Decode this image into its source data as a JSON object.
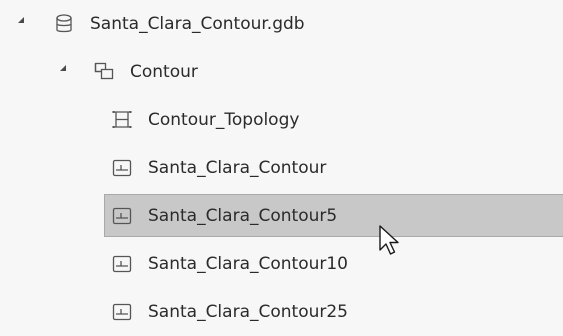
{
  "tree": {
    "database": {
      "label": "Santa_Clara_Contour.gdb",
      "icon": "database-icon",
      "expanded": true
    },
    "dataset": {
      "label": "Contour",
      "icon": "feature-dataset-icon",
      "expanded": true
    },
    "items": [
      {
        "label": "Contour_Topology",
        "icon": "topology-icon",
        "selected": false
      },
      {
        "label": "Santa_Clara_Contour",
        "icon": "line-feature-class-icon",
        "selected": false
      },
      {
        "label": "Santa_Clara_Contour5",
        "icon": "line-feature-class-icon",
        "selected": true
      },
      {
        "label": "Santa_Clara_Contour10",
        "icon": "line-feature-class-icon",
        "selected": false
      },
      {
        "label": "Santa_Clara_Contour25",
        "icon": "line-feature-class-icon",
        "selected": false
      }
    ]
  },
  "colors": {
    "background": "#f7f7f7",
    "selection": "#c8c8c8",
    "selection_border": "#a9a9a9",
    "text": "#2b2b2b",
    "icon_stroke": "#555555"
  }
}
